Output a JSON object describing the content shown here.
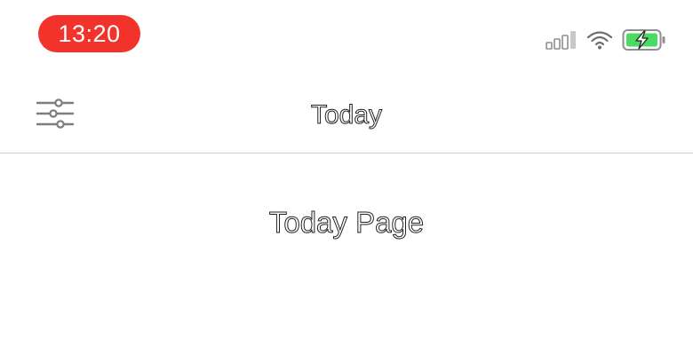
{
  "status_bar": {
    "time": "13:20",
    "time_pill_color": "#f2332b",
    "icons": [
      "cellular-signal-icon",
      "wifi-icon",
      "battery-charging-icon"
    ],
    "battery_color": "#4cd964"
  },
  "nav": {
    "title": "Today",
    "left_icon": "filter-sliders-icon"
  },
  "content": {
    "label": "Today Page"
  }
}
